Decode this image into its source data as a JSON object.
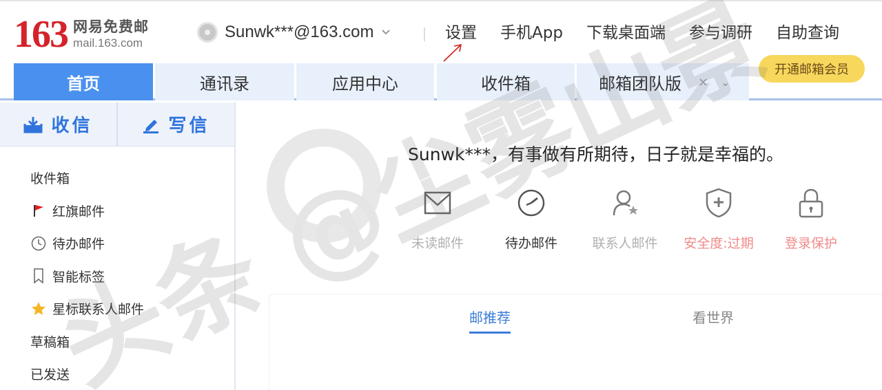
{
  "logo": {
    "number": "163",
    "name_cn": "网易免费邮",
    "domain": "mail.163.com"
  },
  "account": {
    "email": "Sunwk***@163.com"
  },
  "top_links": [
    "设置",
    "手机App",
    "下载桌面端",
    "参与调研",
    "自助查询"
  ],
  "tabs": [
    {
      "label": "首页",
      "active": true
    },
    {
      "label": "通讯录"
    },
    {
      "label": "应用中心"
    },
    {
      "label": "收件箱"
    },
    {
      "label": "邮箱团队版",
      "close": "×",
      "chevron": "⌄"
    }
  ],
  "vip_button": "开通邮箱会员",
  "sidebar": {
    "receive_label": "收信",
    "compose_label": "写信",
    "items": [
      {
        "label": "收件箱",
        "icon": ""
      },
      {
        "label": "红旗邮件",
        "icon": "red-flag-icon"
      },
      {
        "label": "待办邮件",
        "icon": "clock-icon"
      },
      {
        "label": "智能标签",
        "icon": "bookmark-icon"
      },
      {
        "label": "星标联系人邮件",
        "icon": "star-icon"
      },
      {
        "label": "草稿箱",
        "icon": ""
      },
      {
        "label": "已发送",
        "icon": ""
      }
    ]
  },
  "main": {
    "greeting": "Sunwk***，有事做有所期待，日子就是幸福的。",
    "quick_actions": [
      {
        "label": "未读邮件",
        "icon": "envelope-icon",
        "color": "#b0b0b0"
      },
      {
        "label": "待办邮件",
        "icon": "timer-icon",
        "color": "#333333"
      },
      {
        "label": "联系人邮件",
        "icon": "contact-star-icon",
        "color": "#b0b0b0"
      },
      {
        "label": "安全度:过期",
        "icon": "shield-plus-icon",
        "color": "#f08a8a"
      },
      {
        "label": "登录保护",
        "icon": "lock-icon",
        "color": "#f08a8a"
      }
    ],
    "feed_tabs": [
      {
        "label": "邮推荐",
        "active": true
      },
      {
        "label": "看世界",
        "active": false
      }
    ]
  },
  "watermark": {
    "text": "头条 @尘雾山景"
  },
  "colors": {
    "brand_red": "#d4232b",
    "tab_active": "#4a90ee",
    "link_blue": "#2f74dc",
    "vip_yellow": "#f7d75c",
    "warning_red": "#f08a8a"
  }
}
